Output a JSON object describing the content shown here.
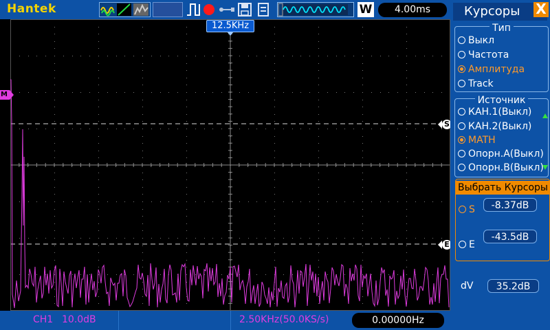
{
  "brand": "Hantek",
  "toolbar": {
    "icons": [
      "wave-mode-icon",
      "trigger-edge-icon",
      "run-stop-icon",
      "usb-icon",
      "save-icon",
      "memory-icon"
    ],
    "wave_mode_letter": "W",
    "timebase": "4.00ms"
  },
  "trace": {
    "freq_marker": "12.5KHz",
    "channel_marker": "M",
    "cursor_s": "S",
    "cursor_e": "E",
    "color": "#e03ce0"
  },
  "bottom": {
    "channel": "CH1",
    "scale": "10.0dB",
    "sample": "2.50KHz(50.0KS/s)",
    "frequency": "0.00000Hz"
  },
  "panel": {
    "title": "Курсоры",
    "close": "X",
    "type_group": {
      "title": "Тип",
      "options": [
        "Выкл",
        "Частота",
        "Амплитуда",
        "Track"
      ],
      "selected": "Амплитуда"
    },
    "source_group": {
      "title": "Источник",
      "options": [
        "КАН.1(Выкл)",
        "КАН.2(Выкл)",
        "MATH",
        "Опорн.A(Выкл)",
        "Опорн.B(Выкл)"
      ],
      "selected": "MATH"
    },
    "select_group": {
      "title": "Выбрать  Курсоры",
      "s_label": "S",
      "s_value": "-8.37dB",
      "e_label": "E",
      "e_value": "-43.5dB"
    },
    "dv_label": "dV",
    "dv_value": "35.2dB"
  },
  "colors": {
    "bar": "#0d52a6",
    "accent": "#f08a00",
    "trace": "#e03ce0",
    "brand": "#f5d400"
  }
}
